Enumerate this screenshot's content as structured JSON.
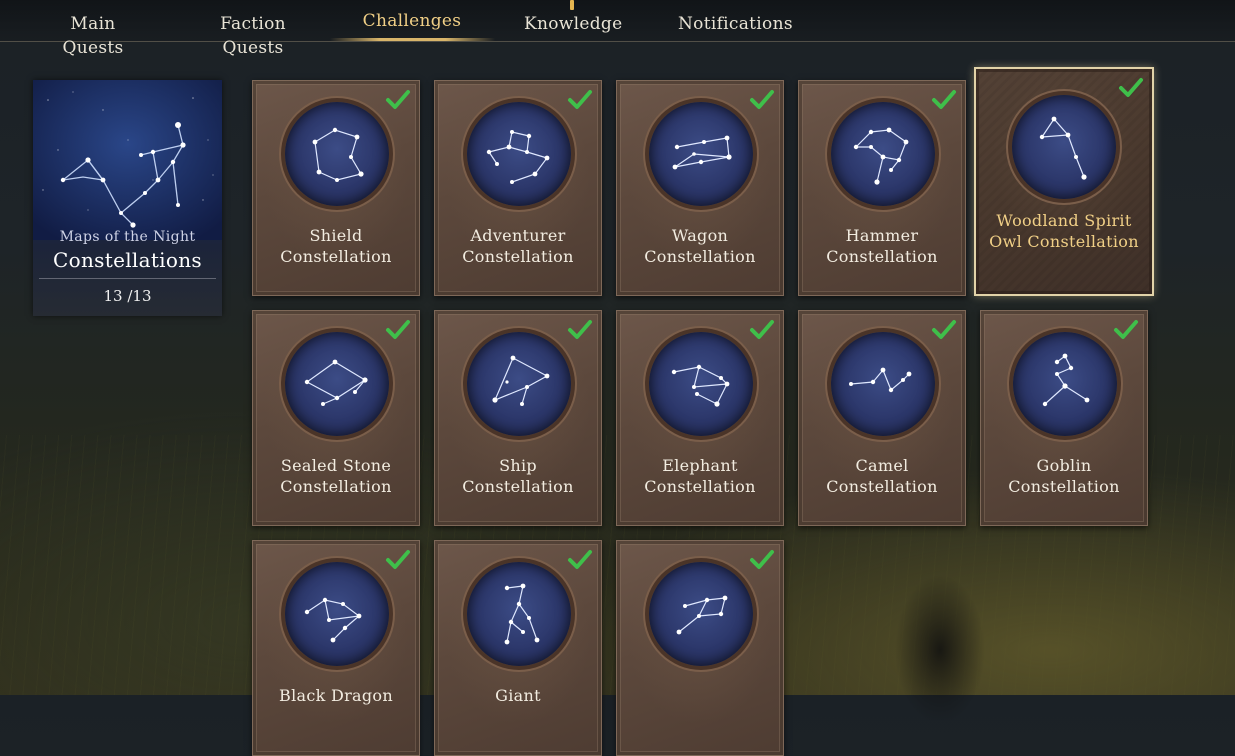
{
  "tabs": [
    {
      "label": "Main Quests",
      "active": false
    },
    {
      "label": "Faction Quests",
      "active": false
    },
    {
      "label": "Challenges",
      "active": true
    },
    {
      "label": "Knowledge",
      "active": false
    },
    {
      "label": "Notifications",
      "active": false
    }
  ],
  "summary": {
    "subtitle": "Maps of the Night",
    "title": "Constellations",
    "count": "13 /13"
  },
  "cards": [
    {
      "line1": "Shield",
      "line2": "Constellation",
      "completed": true,
      "selected": false
    },
    {
      "line1": "Adventurer",
      "line2": "Constellation",
      "completed": true,
      "selected": false
    },
    {
      "line1": "Wagon",
      "line2": "Constellation",
      "completed": true,
      "selected": false
    },
    {
      "line1": "Hammer",
      "line2": "Constellation",
      "completed": true,
      "selected": false
    },
    {
      "line1": "Woodland Spirit",
      "line2": "Owl Constellation",
      "completed": true,
      "selected": true
    },
    {
      "line1": "Sealed Stone",
      "line2": "Constellation",
      "completed": true,
      "selected": false
    },
    {
      "line1": "Ship",
      "line2": "Constellation",
      "completed": true,
      "selected": false
    },
    {
      "line1": "Elephant",
      "line2": "Constellation",
      "completed": true,
      "selected": false
    },
    {
      "line1": "Camel",
      "line2": "Constellation",
      "completed": true,
      "selected": false
    },
    {
      "line1": "Goblin",
      "line2": "Constellation",
      "completed": true,
      "selected": false
    },
    {
      "line1": "Black Dragon",
      "line2": "",
      "completed": true,
      "selected": false
    },
    {
      "line1": "Giant",
      "line2": "",
      "completed": true,
      "selected": false
    },
    {
      "line1": "",
      "line2": "",
      "completed": true,
      "selected": false
    }
  ],
  "colors": {
    "accent_gold": "#f0cf86",
    "check_green": "#3fbf4a",
    "card_brown": "#5c483c",
    "medallion_blue": "#2b3669"
  },
  "icons": {
    "check": "checkmark-icon",
    "constellation": "constellation-icon"
  }
}
